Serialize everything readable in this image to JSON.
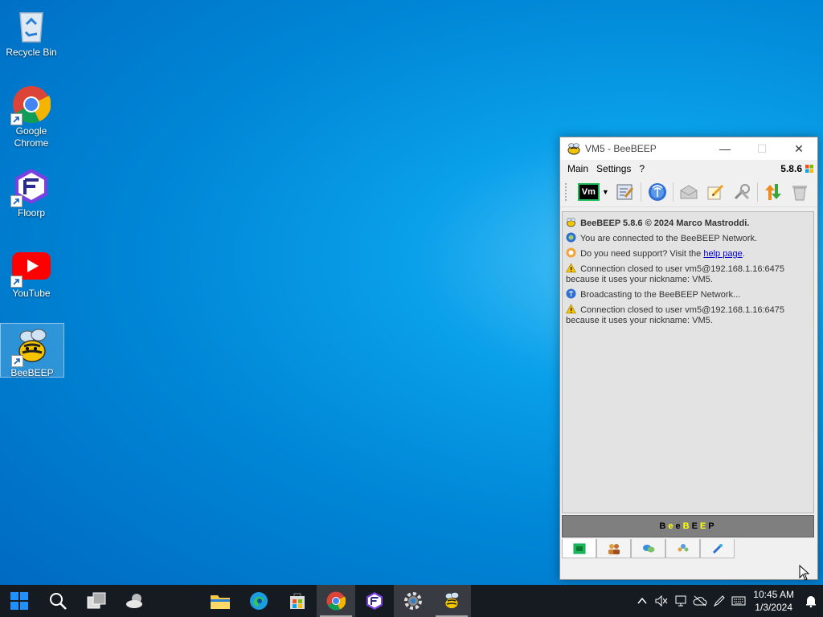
{
  "desktop": {
    "icons": [
      {
        "label": "Recycle Bin"
      },
      {
        "label": "Google Chrome"
      },
      {
        "label": "Floorp"
      },
      {
        "label": "YouTube"
      },
      {
        "label": "BeeBEEP"
      }
    ]
  },
  "window": {
    "title": "VM5 - BeeBEEP",
    "controls": {
      "minimize": "—",
      "maximize": "☐",
      "close": "✕"
    },
    "menu": {
      "main": "Main",
      "settings": "Settings",
      "help": "?"
    },
    "version": "5.8.6",
    "toolbar": {
      "status_label": "Vm"
    },
    "log": {
      "header": "BeeBEEP 5.8.6 © 2024 Marco Mastroddi.",
      "connected": "You are connected to the BeeBEEP Network.",
      "support_prefix": "Do you need support? Visit the ",
      "support_link": "help page",
      "support_suffix": ".",
      "closed1_line1": "Connection closed to user vm5@192.168.1.16:6475",
      "closed1_line2": "because it uses your nickname: VM5.",
      "broadcast": "Broadcasting to the BeeBEEP Network...",
      "closed2_line1": "Connection closed to user vm5@192.168.1.16:6475",
      "closed2_line2": "because it uses your nickname: VM5."
    },
    "brand_letters": [
      "B",
      "e",
      "e",
      "B",
      "E",
      "E",
      "P"
    ],
    "brand_colors": [
      "#000000",
      "#ffff00",
      "#000000",
      "#ffff00",
      "#000000",
      "#ffff00",
      "#000000"
    ]
  },
  "taskbar": {
    "clock_time": "10:45 AM",
    "clock_date": "1/3/2024"
  },
  "colors": {
    "accent": "#0078d4",
    "taskbar": "#161b22",
    "brand_bar": "#7f7f7f"
  }
}
